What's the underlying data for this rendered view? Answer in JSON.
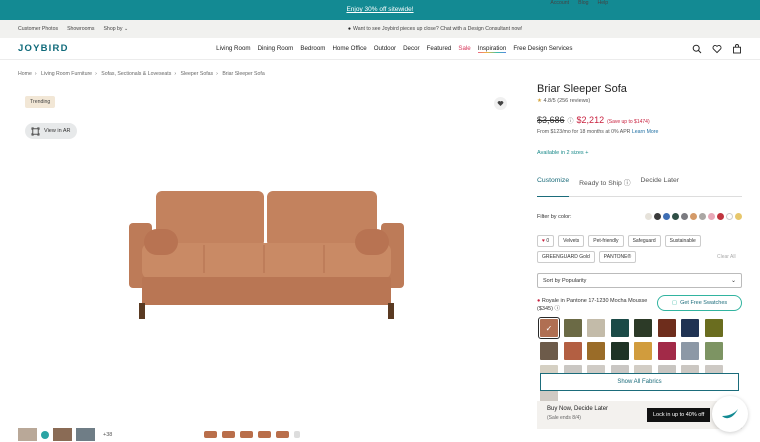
{
  "promo": {
    "text": "Enjoy 30% off sitewide!"
  },
  "util": {
    "left": [
      "Customer Photos",
      "Showrooms",
      "Shop by"
    ],
    "center": "Want to see Joybird pieces up close? Chat with a Design Consultant now!",
    "right": [
      "Account",
      "Blog",
      "Help"
    ]
  },
  "nav": {
    "logo": "JOYBIRD",
    "links": [
      "Living Room",
      "Dining Room",
      "Bedroom",
      "Home Office",
      "Outdoor",
      "Decor",
      "Featured",
      "Sale",
      "Inspiration",
      "Free Design Services"
    ]
  },
  "breadcrumb": [
    "Home",
    "Living Room Furniture",
    "Sofas, Sectionals & Loveseats",
    "Sleeper Sofas",
    "Briar Sleeper Sofa"
  ],
  "gallery": {
    "badge": "Trending",
    "view_ar": "View in AR",
    "more_count": "+38"
  },
  "product": {
    "title": "Briar Sleeper Sofa",
    "rating": "4.8/5",
    "reviews": "(256 reviews)",
    "old_price": "$3,686",
    "new_price": "$2,212",
    "savings": "(Save up to $1474)",
    "financing": "From $123/mo for 18 months at 0% APR",
    "financing_link": "Learn More",
    "sizes": "Available in 2 sizes +"
  },
  "tabs": [
    "Customize",
    "Ready to Ship",
    "Decide Later"
  ],
  "filter": {
    "label": "Filter by color:",
    "colors": [
      "#e6e2da",
      "#3b3b3b",
      "#3f6fb5",
      "#2f4f46",
      "#7b7b80",
      "#d49a68",
      "#aaa7a4",
      "#e8a8b8",
      "#c0343e",
      "#ffffff",
      "#e7c76c"
    ],
    "chips": [
      "0",
      "Velvets",
      "Pet-friendly",
      "Safeguard",
      "Sustainable",
      "GREENGUARD Gold",
      "PANTONE®"
    ],
    "clear_all": "Clear All"
  },
  "sort": {
    "value": "Sort by Popularity"
  },
  "selected_fabric": {
    "name": "Royale in Pantone 17-1230 Mocha Mousse",
    "price": "($345)"
  },
  "swatch_button": "Get Free Swatches",
  "swatches": [
    "#b06f52",
    "#6b6a45",
    "#c3bba9",
    "#1b4a47",
    "#2c3a27",
    "#6e2d1c",
    "#1f3253",
    "#6a6d1f",
    "#6d5b4a",
    "#b35f42",
    "#9a6c28",
    "#1e3325",
    "#d19c3d",
    "#a22a48",
    "#8c98a6",
    "#7d9463",
    "#d5d0c3",
    "#cac7c3",
    "#cfcbc5",
    "#c9c6c3",
    "#d2cdc5",
    "#c8c5c1",
    "#cbc7c2",
    "#cdc9c4",
    "#cfcac4"
  ],
  "show_all": "Show All Fabrics",
  "buy_now": {
    "title": "Buy Now, Decide Later",
    "sub": "(Sale ends 8/4)",
    "lock": "Lock in up to 40% off"
  }
}
